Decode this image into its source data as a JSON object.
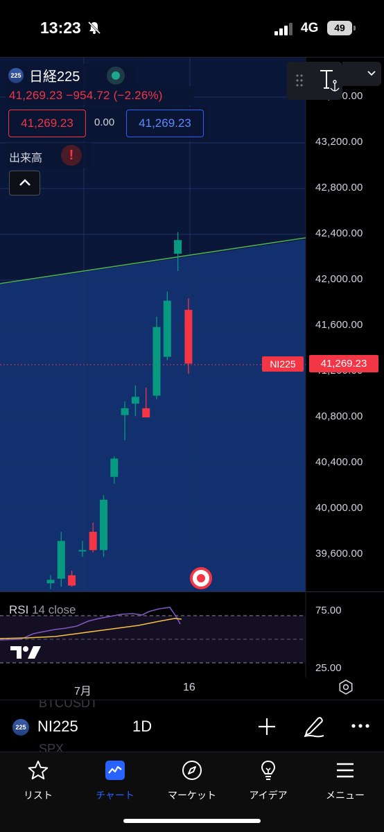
{
  "status_bar": {
    "time": "13:23",
    "network": "4G",
    "battery": "49"
  },
  "chart": {
    "symbol_badge": "225",
    "symbol_name": "日経225",
    "change_text": "41,269.23  −954.72 (−2.26%)",
    "bid": "41,269.23",
    "spread": "0.00",
    "ask": "41,269.23",
    "volume_label": "出来高",
    "warning_mark": "!",
    "price_axis": [
      "43,600.00",
      "43,200.00",
      "42,800.00",
      "42,400.00",
      "42,000.00",
      "41,600.00",
      "41,200.00",
      "40,800.00",
      "40,400.00",
      "40,000.00",
      "39,600.00"
    ],
    "last_price_symbol": "NI225",
    "last_price": "41,269.23",
    "colors": {
      "up": "#089981",
      "down": "#f23645",
      "background": "#0f2356",
      "trendline": "#4caf50",
      "accent": "#2962ff"
    }
  },
  "chart_data": {
    "type": "candlestick",
    "y_axis_range": [
      39400,
      43800
    ],
    "last_price_value": 41269.23,
    "candles": [
      {
        "o": 39350,
        "h": 39420,
        "l": 39300,
        "c": 39380
      },
      {
        "o": 39390,
        "h": 39800,
        "l": 39320,
        "c": 39720
      },
      {
        "o": 39420,
        "h": 39460,
        "l": 39320,
        "c": 39330
      },
      {
        "o": 39640,
        "h": 39720,
        "l": 39580,
        "c": 39640
      },
      {
        "o": 39800,
        "h": 39880,
        "l": 39620,
        "c": 39640
      },
      {
        "o": 39640,
        "h": 40120,
        "l": 39580,
        "c": 40080
      },
      {
        "o": 40280,
        "h": 40460,
        "l": 40220,
        "c": 40440
      },
      {
        "o": 40820,
        "h": 40940,
        "l": 40600,
        "c": 40880
      },
      {
        "o": 40920,
        "h": 41080,
        "l": 40810,
        "c": 40980
      },
      {
        "o": 40880,
        "h": 41060,
        "l": 40820,
        "c": 40800
      },
      {
        "o": 40990,
        "h": 41680,
        "l": 40960,
        "c": 41590
      },
      {
        "o": 41330,
        "h": 41900,
        "l": 41300,
        "c": 41820
      },
      {
        "o": 42230,
        "h": 42420,
        "l": 42080,
        "c": 42350
      },
      {
        "o": 41740,
        "h": 41840,
        "l": 41180,
        "c": 41270
      }
    ],
    "rsi": {
      "name": "RSI",
      "params": "14 close",
      "levels": [
        "75.00",
        "25.00"
      ]
    },
    "time_axis": [
      "7月",
      "16"
    ]
  },
  "toolbar": {
    "symbol_badge": "225",
    "symbol": "NI225",
    "interval": "1D",
    "ghost_top": "BTCUSDT",
    "ghost_bottom": "SPX"
  },
  "nav": {
    "items": [
      {
        "label": "リスト",
        "icon": "star-icon"
      },
      {
        "label": "チャート",
        "icon": "chart-icon"
      },
      {
        "label": "マーケット",
        "icon": "compass-icon"
      },
      {
        "label": "アイデア",
        "icon": "lightbulb-icon"
      },
      {
        "label": "メニュー",
        "icon": "menu-icon"
      }
    ]
  }
}
